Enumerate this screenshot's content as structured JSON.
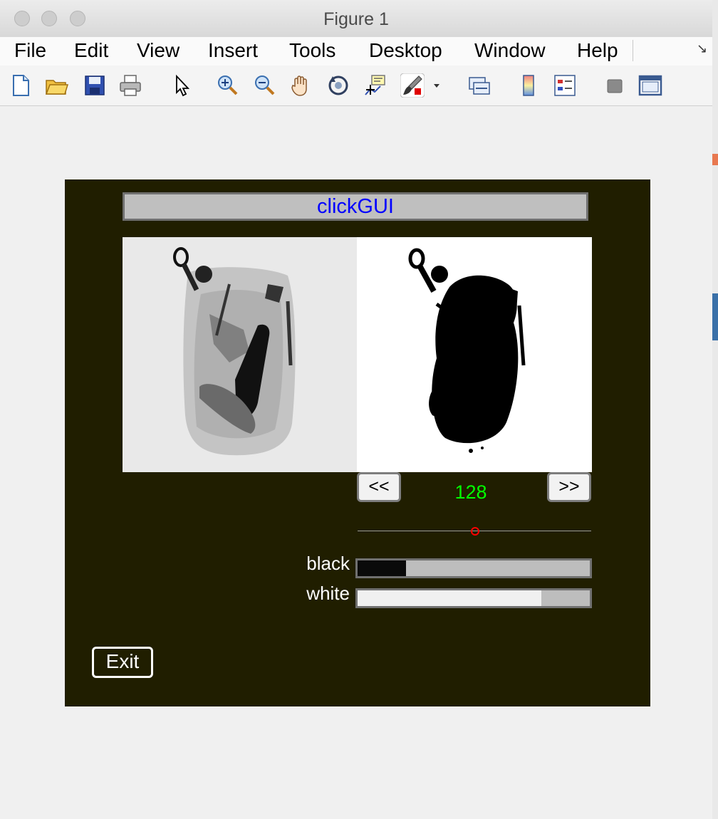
{
  "window": {
    "title": "Figure 1"
  },
  "menu": {
    "items": [
      "File",
      "Edit",
      "View",
      "Insert",
      "Tools",
      "Desktop",
      "Window",
      "Help"
    ]
  },
  "toolbar": {
    "icons": [
      "new-figure-icon",
      "open-file-icon",
      "save-icon",
      "print-icon",
      "pointer-icon",
      "zoom-in-icon",
      "zoom-out-icon",
      "pan-hand-icon",
      "rotate-3d-icon",
      "data-cursor-icon",
      "brush-icon",
      "brush-dropdown-icon",
      "link-plot-icon",
      "colorbar-icon",
      "legend-icon",
      "hide-tools-icon",
      "dock-icon"
    ]
  },
  "gui": {
    "title": "clickGUI",
    "prev_label": "<<",
    "next_label": ">>",
    "threshold_value": "128",
    "slider": {
      "min": 0,
      "max": 255,
      "value": 128
    },
    "black_label": "black",
    "white_label": "white",
    "black_level": 0.21,
    "white_level": 0.79,
    "exit_label": "Exit"
  },
  "colors": {
    "panel_bg": "#201e00",
    "title_text": "#0000ff",
    "value_text": "#00ff00",
    "thumb": "#ff0000"
  }
}
